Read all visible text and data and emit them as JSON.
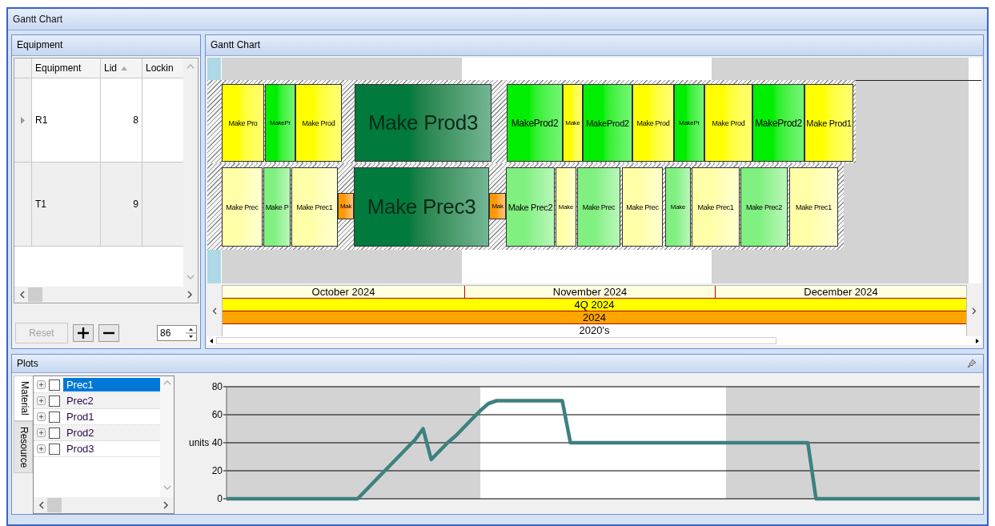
{
  "window": {
    "title": "Gantt Chart"
  },
  "equipment_panel": {
    "title": "Equipment",
    "columns": [
      {
        "label": "Equipment",
        "sorted": false
      },
      {
        "label": "Lid",
        "sorted": true
      },
      {
        "label": "Lockin",
        "sorted": false
      }
    ],
    "rows": [
      {
        "equipment": "R1",
        "lid": "8",
        "current": true
      },
      {
        "equipment": "T1",
        "lid": "9",
        "current": false
      }
    ],
    "reset_button": {
      "label": "Reset",
      "disabled": true
    },
    "zoom_value": "86"
  },
  "gantt_panel": {
    "title": "Gantt Chart",
    "rows": [
      {
        "bars": [
          {
            "label": "Make Pro",
            "color": "#ffff00"
          },
          {
            "label": "MakePr",
            "color": "#00ee00"
          },
          {
            "label": "Make Prod",
            "color": "#ffff00"
          },
          {
            "label": "Make Prod3",
            "color": "#007a3d"
          },
          {
            "label": "MakeProd2",
            "color": "#00ee00"
          },
          {
            "label": "Make",
            "color": "#ffff00"
          },
          {
            "label": "MakeProd2",
            "color": "#00ee00"
          },
          {
            "label": "Make Prod",
            "color": "#ffff00"
          },
          {
            "label": "MakePr",
            "color": "#00ee00"
          },
          {
            "label": "Make Prod",
            "color": "#ffff00"
          },
          {
            "label": "MakeProd2",
            "color": "#00ee00"
          },
          {
            "label": "Make Prod1",
            "color": "#ffff00"
          }
        ]
      },
      {
        "bars": [
          {
            "label": "Make Prec",
            "color": "#ffffa8"
          },
          {
            "label": "Make P",
            "color": "#80f080"
          },
          {
            "label": "Make Prec1",
            "color": "#ffffa8"
          },
          {
            "label": "Mak",
            "color": "#ff9900"
          },
          {
            "label": "Make Prec3",
            "color": "#007a3d"
          },
          {
            "label": "Mak",
            "color": "#ff9900"
          },
          {
            "label": "Make Prec2",
            "color": "#80f080"
          },
          {
            "label": "Make",
            "color": "#ffffa8"
          },
          {
            "label": "Make Prec",
            "color": "#80f080"
          },
          {
            "label": "Make Prec",
            "color": "#ffffa8"
          },
          {
            "label": "Make",
            "color": "#80f080"
          },
          {
            "label": "Make Prec1",
            "color": "#ffffa8"
          },
          {
            "label": "Make Prec2",
            "color": "#80f080"
          },
          {
            "label": "Make Prec1",
            "color": "#ffffa8"
          }
        ]
      }
    ],
    "timescale": [
      {
        "kind": "months",
        "cells": [
          "October 2024",
          "November 2024",
          "December 2024"
        ]
      },
      {
        "kind": "quarter",
        "cells": [
          "4Q 2024"
        ]
      },
      {
        "kind": "year",
        "cells": [
          "2024"
        ]
      },
      {
        "kind": "decade",
        "cells": [
          "2020's"
        ]
      }
    ]
  },
  "plots_panel": {
    "title": "Plots",
    "tabs": [
      {
        "label": "Material",
        "selected": true
      },
      {
        "label": "Resource",
        "selected": false
      }
    ],
    "items": [
      {
        "label": "Prec1",
        "selected": true,
        "checked": false,
        "expanded": false
      },
      {
        "label": "Prec2",
        "selected": false,
        "checked": false,
        "expanded": false
      },
      {
        "label": "Prod1",
        "selected": false,
        "checked": false,
        "expanded": false
      },
      {
        "label": "Prod2",
        "selected": false,
        "checked": false,
        "expanded": false
      },
      {
        "label": "Prod3",
        "selected": false,
        "checked": false,
        "expanded": false
      }
    ],
    "chart_data": {
      "type": "line",
      "grid": true,
      "ylabel": "units",
      "ylim": [
        0,
        80
      ],
      "yticks": [
        0,
        20,
        40,
        60,
        80
      ],
      "categories": [
        null,
        null,
        null,
        null,
        null,
        null,
        null,
        null,
        null,
        null,
        null,
        null,
        null,
        null,
        null,
        null,
        null,
        null,
        null,
        null,
        null,
        null,
        null,
        null,
        null,
        null,
        null,
        null,
        null,
        null,
        null,
        null,
        null,
        null,
        null,
        null,
        null,
        null,
        null,
        null,
        null,
        null,
        null,
        null,
        null,
        null,
        null,
        null,
        null,
        null,
        null,
        null,
        null,
        null,
        null,
        null,
        null,
        null,
        null,
        null,
        null,
        null,
        null,
        null,
        null,
        null,
        null,
        null,
        null,
        null,
        null,
        null,
        null,
        null,
        null,
        null,
        null,
        null,
        null,
        null,
        null,
        null,
        null,
        null,
        null,
        null,
        null,
        null,
        null,
        null,
        null,
        null,
        null
      ],
      "series": [
        {
          "color": "#3e8080",
          "values": [
            0,
            0,
            0,
            0,
            0,
            0,
            0,
            0,
            0,
            0,
            0,
            0,
            0,
            0,
            0,
            0,
            0,
            6,
            12,
            18,
            24,
            30,
            36,
            42,
            50,
            28,
            34,
            40,
            45,
            51,
            57,
            63,
            68,
            70,
            70,
            70,
            70,
            70,
            70,
            70,
            70,
            70,
            40,
            40,
            40,
            40,
            40,
            40,
            40,
            40,
            40,
            40,
            40,
            40,
            40,
            40,
            40,
            40,
            40,
            40,
            40,
            40,
            40,
            40,
            40,
            40,
            40,
            40,
            40,
            40,
            40,
            40,
            0,
            0,
            0,
            0,
            0,
            0,
            0,
            0,
            0,
            0,
            0,
            0,
            0,
            0,
            0,
            0,
            0,
            0,
            0,
            0,
            0
          ]
        }
      ]
    }
  }
}
